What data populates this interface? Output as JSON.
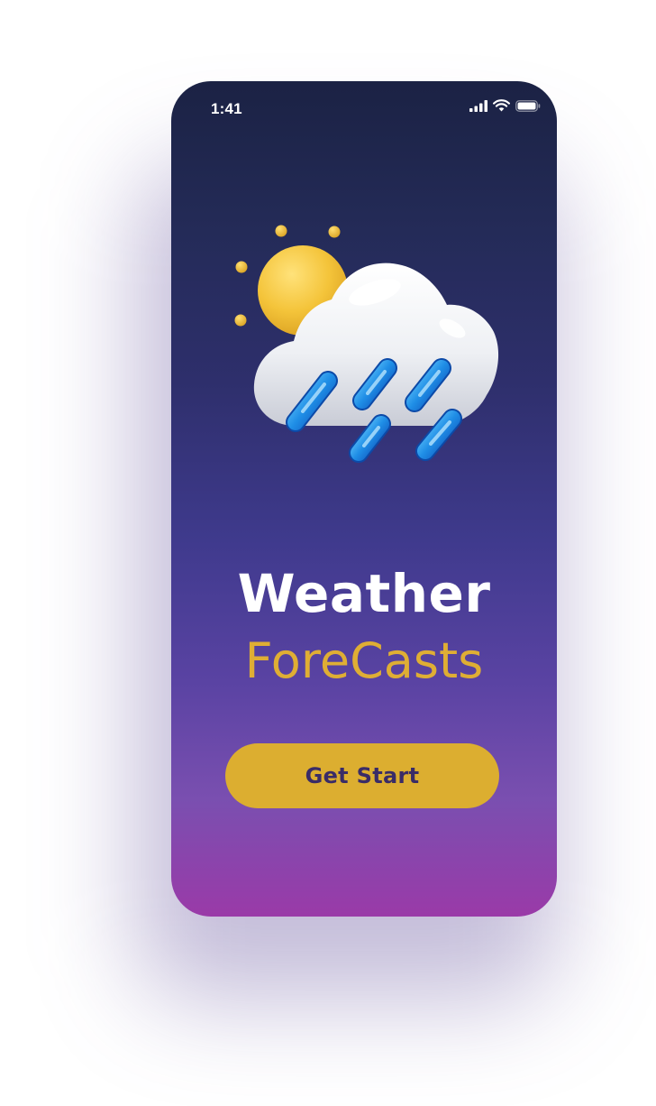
{
  "status_bar": {
    "time": "1:41",
    "icons": [
      "signal-icon",
      "wifi-icon",
      "battery-icon"
    ]
  },
  "illustration": {
    "icon": "sun-cloud-rain-icon"
  },
  "title": {
    "line1": "Weather",
    "line2": "ForeCasts"
  },
  "cta": {
    "label": "Get Start"
  },
  "colors": {
    "accent": "#DCAE30",
    "title_accent": "#DFAE34",
    "button_text": "#3A2C67",
    "background_top": "#1B2244",
    "background_bottom": "#9A3AA8"
  }
}
